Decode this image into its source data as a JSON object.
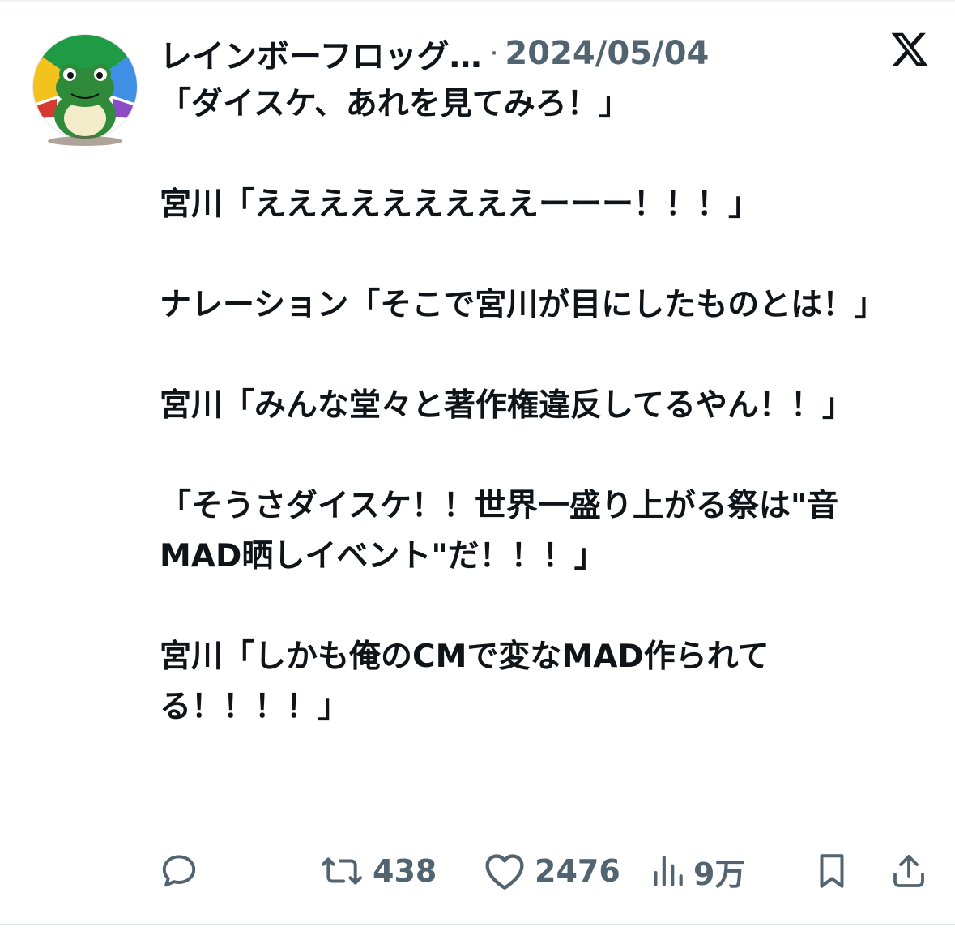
{
  "post": {
    "display_name": "レインボーフロッグ…",
    "separator": "·",
    "date": "2024/05/04",
    "lines": [
      "「ダイスケ、あれを見てみろ！」",
      "",
      "宮川「えええええええええーーー！！！」",
      "",
      "ナレーション「そこで宮川が目にしたものとは！」",
      "",
      "宮川「みんな堂々と著作権違反してるやん！！」",
      "",
      "「そうさダイスケ！！世界一盛り上がる祭は\"音MAD晒しイベント\"だ！！！」",
      "",
      "宮川「しかも俺のCMで変なMAD作られてる！！！！」"
    ]
  },
  "actions": {
    "reply_icon": "reply-icon",
    "retweet_icon": "retweet-icon",
    "retweet_count": "438",
    "like_icon": "heart-icon",
    "like_count": "2476",
    "views_icon": "views-chart-icon",
    "views_count": "9万",
    "bookmark_icon": "bookmark-icon",
    "share_icon": "share-icon"
  },
  "branding": {
    "platform_icon": "x-logo-icon",
    "avatar_icon": "frog-avatar-icon"
  },
  "colors": {
    "text_primary": "#0f1419",
    "text_secondary": "#536471",
    "avatar_blue": "#3f8fe6",
    "avatar_yellow": "#f4c21d",
    "avatar_green": "#1f9a45",
    "avatar_red": "#d63a32",
    "avatar_purple": "#8a4bc4"
  }
}
